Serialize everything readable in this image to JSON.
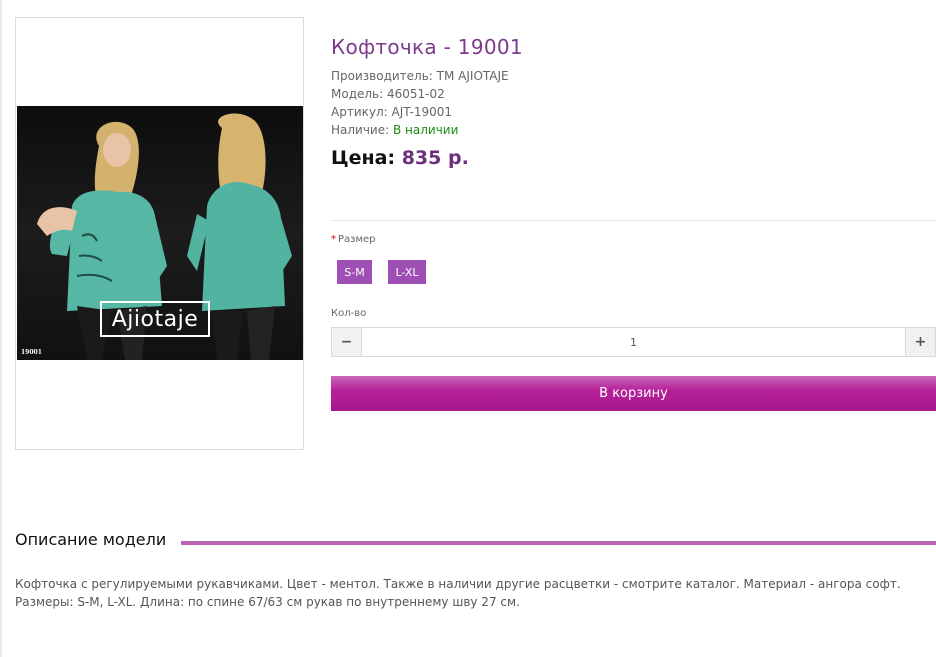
{
  "product": {
    "title": "Кофточка - 19001",
    "image": {
      "brand": "Ajiotaje",
      "code": "19001"
    },
    "specs": {
      "manufacturer_label": "Производитель:",
      "manufacturer_value": "ТМ AJIOTAJE",
      "model_label": "Модель:",
      "model_value": "46051-02",
      "sku_label": "Артикул:",
      "sku_value": "AJT-19001",
      "availability_label": "Наличие:",
      "availability_value": "В наличии"
    },
    "price": {
      "label": "Цена:",
      "value": "835 р."
    }
  },
  "options": {
    "required_mark": "*",
    "size_label": "Размер",
    "sizes": [
      "S-M",
      "L-XL"
    ]
  },
  "quantity": {
    "label": "Кол-во",
    "value": "1",
    "minus": "−",
    "plus": "+"
  },
  "cart": {
    "button_label": "В корзину"
  },
  "description": {
    "title": "Описание модели",
    "text": "Кофточка с регулируемыми рукавчиками. Цвет - ментол. Также в наличии другие расцветки - смотрите каталог. Материал - ангора софт. Размеры: S-M, L-XL. Длина: по спине 67/63 см рукав по внутреннему шву 27 см."
  },
  "colors": {
    "title": "#7b3a8c",
    "price": "#6b2f7e",
    "instock": "#1f8a12",
    "size_button": "#9d4fb3",
    "cart_button": "#b7219b",
    "accent_line": "#b865b8"
  }
}
